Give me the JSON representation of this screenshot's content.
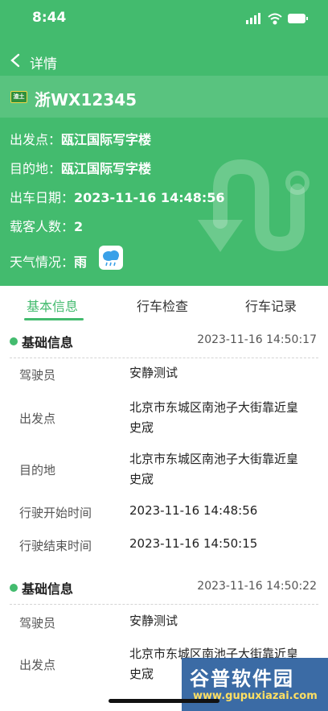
{
  "status": {
    "time": "8:44"
  },
  "nav": {
    "title": "详情"
  },
  "vehicle": {
    "badge": "渣土",
    "plate": "浙WX12345",
    "fields": [
      {
        "label": "出发点：",
        "value": "瓯江国际写字楼"
      },
      {
        "label": "目的地：",
        "value": "瓯江国际写字楼"
      },
      {
        "label": "出车日期：",
        "value": "2023-11-16 14:48:56"
      },
      {
        "label": "载客人数：",
        "value": "2"
      },
      {
        "label": "天气情况：",
        "value": "雨"
      }
    ],
    "weather_icon": "rain-cloud-icon"
  },
  "tabs": [
    {
      "label": "基本信息"
    },
    {
      "label": "行车检查"
    },
    {
      "label": "行车记录"
    }
  ],
  "sections": [
    {
      "title": "基础信息",
      "time": "2023-11-16 14:50:17",
      "rows": [
        {
          "label": "驾驶员",
          "value": "安静测试"
        },
        {
          "label": "出发点",
          "value": "北京市东城区南池子大街靠近皇史宬"
        },
        {
          "label": "目的地",
          "value": "北京市东城区南池子大街靠近皇史宬"
        },
        {
          "label": "行驶开始时间",
          "value": "2023-11-16 14:48:56"
        },
        {
          "label": "行驶结束时间",
          "value": "2023-11-16 14:50:15"
        }
      ]
    },
    {
      "title": "基础信息",
      "time": "2023-11-16 14:50:22",
      "rows": [
        {
          "label": "驾驶员",
          "value": "安静测试"
        },
        {
          "label": "出发点",
          "value": "北京市东城区南池子大街靠近皇史宬"
        }
      ]
    }
  ],
  "watermark": {
    "title": "谷普软件园",
    "url": "www.gupuxiazai.com"
  },
  "colors": {
    "accent": "#43bb6e",
    "text": "#1f1f1f"
  }
}
